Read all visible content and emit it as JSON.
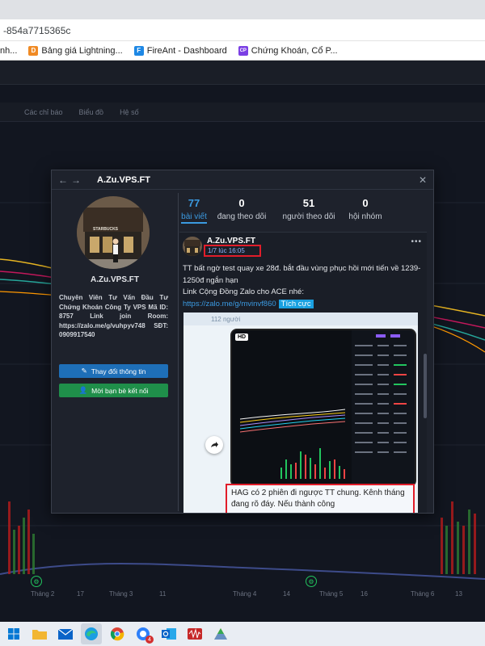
{
  "browser": {
    "url": "-854a7715365c",
    "bookmarks": [
      {
        "label": "nh...",
        "icon": "",
        "color": ""
      },
      {
        "label": "Bảng giá Lightning...",
        "icon": "D",
        "color": "#f08a24"
      },
      {
        "label": "FireAnt - Dashboard",
        "icon": "F",
        "color": "#1e88e5"
      },
      {
        "label": "Chứng Khoán, Cổ P...",
        "icon": "CP",
        "color": "#7b3fe4"
      }
    ]
  },
  "background_app": {
    "toolbar_items": [
      "Các chỉ báo",
      "Biểu đồ",
      "Hệ số"
    ],
    "time_axis": [
      "Tháng 2",
      "17",
      "Tháng 3",
      "11",
      "Tháng 4",
      "14",
      "Tháng 5",
      "16",
      "Tháng 6",
      "13"
    ]
  },
  "modal": {
    "title": "A.Zu.VPS.FT",
    "profile": {
      "name": "A.Zu.VPS.FT",
      "bio": "Chuyên Viên Tư Vấn Đầu Tư Chứng Khoán Công Ty VPS Mã ID: 8757 Link join Room: https://zalo.me/g/vuhpyv748 SĐT: 0909917540",
      "avatar_text": "STARBUCKS",
      "edit_button": "Thay đổi thông tin",
      "invite_button": "Mời bạn bè kết nối"
    },
    "stats": [
      {
        "value": "77",
        "label": "bài viết"
      },
      {
        "value": "0",
        "label": "đang theo dõi"
      },
      {
        "value": "51",
        "label": "người theo dõi"
      },
      {
        "value": "0",
        "label": "hội nhóm"
      }
    ],
    "post": {
      "author": "A.Zu.VPS.FT",
      "time": "1/7 lúc 16:05",
      "text": "TT bất ngờ test quay xe 28đ. bắt đầu vùng phục hồi mới tiến về 1239-1250đ ngắn hạn",
      "link_intro": "Link Cộng Đồng Zalo cho ACE nhé:",
      "link": "https://zalo.me/g/mvinvf860",
      "sentiment": "Tích cực",
      "image": {
        "members": "112 người",
        "hd": "HD",
        "caption": "HAG có 2 phiên đi ngược TT chung. Kênh tháng đang rõ đáy. Nếu thành công"
      }
    }
  },
  "colors": {
    "accent": "#3b9ae1",
    "highlight_border": "#e11d2a",
    "edit_button": "#1e6fb8",
    "invite_button": "#1f8f4a"
  }
}
